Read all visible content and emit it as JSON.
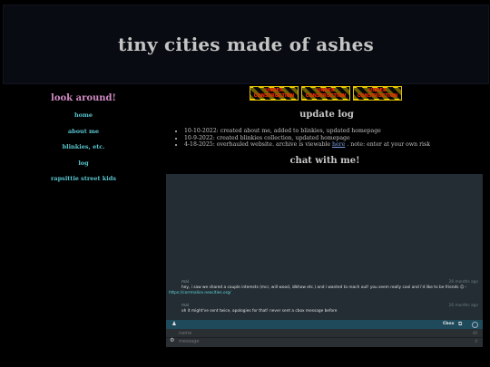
{
  "site": {
    "title": "tiny cities made of ashes"
  },
  "sidebar": {
    "heading": "look around!",
    "links": [
      "home",
      "about me",
      "blinkies, etc.",
      "log",
      "rapsittie street kids"
    ]
  },
  "banners": [
    {
      "text": "UNDER CONSTRUCTION",
      "icon": "under-construction-banner"
    },
    {
      "text": "UNDER CONSTRUCTION",
      "icon": "under-construction-banner"
    },
    {
      "text": "UNDER CONSTRUCTION",
      "icon": "under-construction-banner"
    }
  ],
  "updates": {
    "heading": "update log",
    "items": [
      {
        "text": "10-10-2022: created about me, added to blinkies, updated homepage"
      },
      {
        "text": "10-9-2022: created blinkies collection, updated homepage"
      },
      {
        "pre": "4-18-2025: overhauled website. archive is viewable ",
        "link": "here",
        "post": " . note: enter at your own risk"
      }
    ]
  },
  "chat": {
    "heading": "chat with me!",
    "messages": [
      {
        "user": "mal",
        "time": "26 months ago",
        "text": "hey, i saw we shared a couple interests (mcr, will wood, idkhow etc.) and i wanted to reach out! you seem really cool and i'd like to be friends ☺ -",
        "link": "https://corrmalice.neocities.org/"
      },
      {
        "user": "mal",
        "time": "26 months ago",
        "text": "oh it might've sent twice, apologies for that! never sent a cbox message before",
        "link": ""
      }
    ],
    "toolbar": {
      "brand": "Cbox"
    },
    "form": {
      "name_placeholder": "name",
      "message_placeholder": "message",
      "name_count": "40",
      "message_count": "0"
    }
  },
  "colors": {
    "page_bg": "#000000",
    "header_bg": "#090b12",
    "accent_pink": "#d08bc3",
    "accent_teal": "#58c6cf",
    "chat_bg": "#232d33",
    "chat_bar": "#1f4a5c"
  }
}
